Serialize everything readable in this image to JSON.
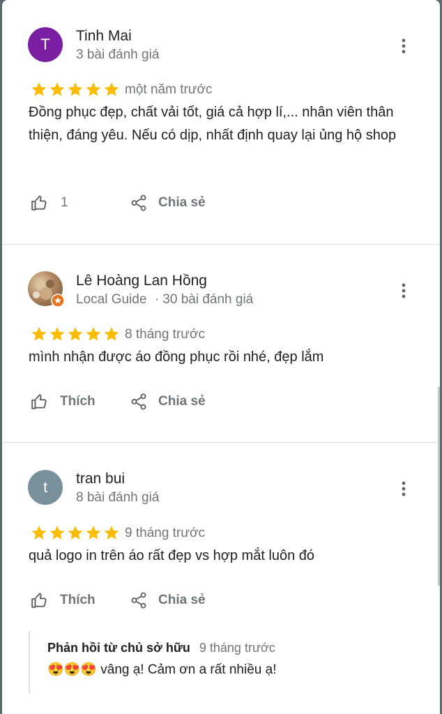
{
  "reviews": [
    {
      "avatar_letter": "T",
      "avatar_color": "#7b1fa2",
      "name": "Tinh Mai",
      "meta": "3 bài đánh giá",
      "rating": 5,
      "time": "một năm trước",
      "text": "Đồng phục đẹp, chất vải tốt, giá cả hợp lí,... nhân viên thân thiện, đáng yêu. Nếu có dịp, nhất định quay lại ủng hộ shop",
      "like_label": "1",
      "share_label": "Chia sẻ"
    },
    {
      "avatar_letter": "",
      "avatar_color": "#b08660",
      "name": "Lê Hoàng Lan Hồng",
      "guide_label": "Local Guide",
      "meta": "· 30 bài đánh giá",
      "rating": 5,
      "time": "8 tháng trước",
      "text": "mình nhận được áo đồng phục rồi nhé, đẹp lắm",
      "like_label": "Thích",
      "share_label": "Chia sẻ"
    },
    {
      "avatar_letter": "t",
      "avatar_color": "#78909c",
      "name": "tran bui",
      "meta": "8 bài đánh giá",
      "rating": 5,
      "time": "9 tháng trước",
      "text": "quả logo in trên áo rất đẹp vs hợp mắt luôn đó",
      "like_label": "Thích",
      "share_label": "Chia sẻ",
      "reply": {
        "owner_label": "Phản hồi từ chủ sở hữu",
        "time": "9 tháng trước",
        "emojis": "😍😍😍",
        "text": "vâng ạ! Cảm ơn a rất nhiều ạ!"
      }
    }
  ],
  "colors": {
    "star": "#fbbc04",
    "text": "#202124",
    "muted": "#70757a"
  }
}
